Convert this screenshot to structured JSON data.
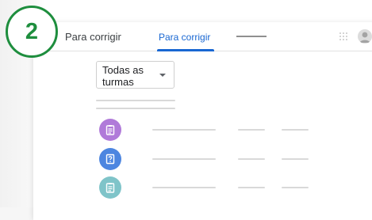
{
  "app": {
    "title": "Para corrigir"
  },
  "tabs": [
    {
      "label": "Para corrigir",
      "active": true
    }
  ],
  "step": {
    "number": "2",
    "color": "#1e8e3e"
  },
  "filter": {
    "selected": "Todas as turmas",
    "icon": "dropdown-arrow-icon"
  },
  "tasks": [
    {
      "icon": "assignment-icon",
      "color": "#b07ad9"
    },
    {
      "icon": "question-icon",
      "color": "#4d86e0"
    },
    {
      "icon": "material-icon",
      "color": "#7fc4c9"
    }
  ],
  "colors": {
    "accent": "#1967d2"
  }
}
